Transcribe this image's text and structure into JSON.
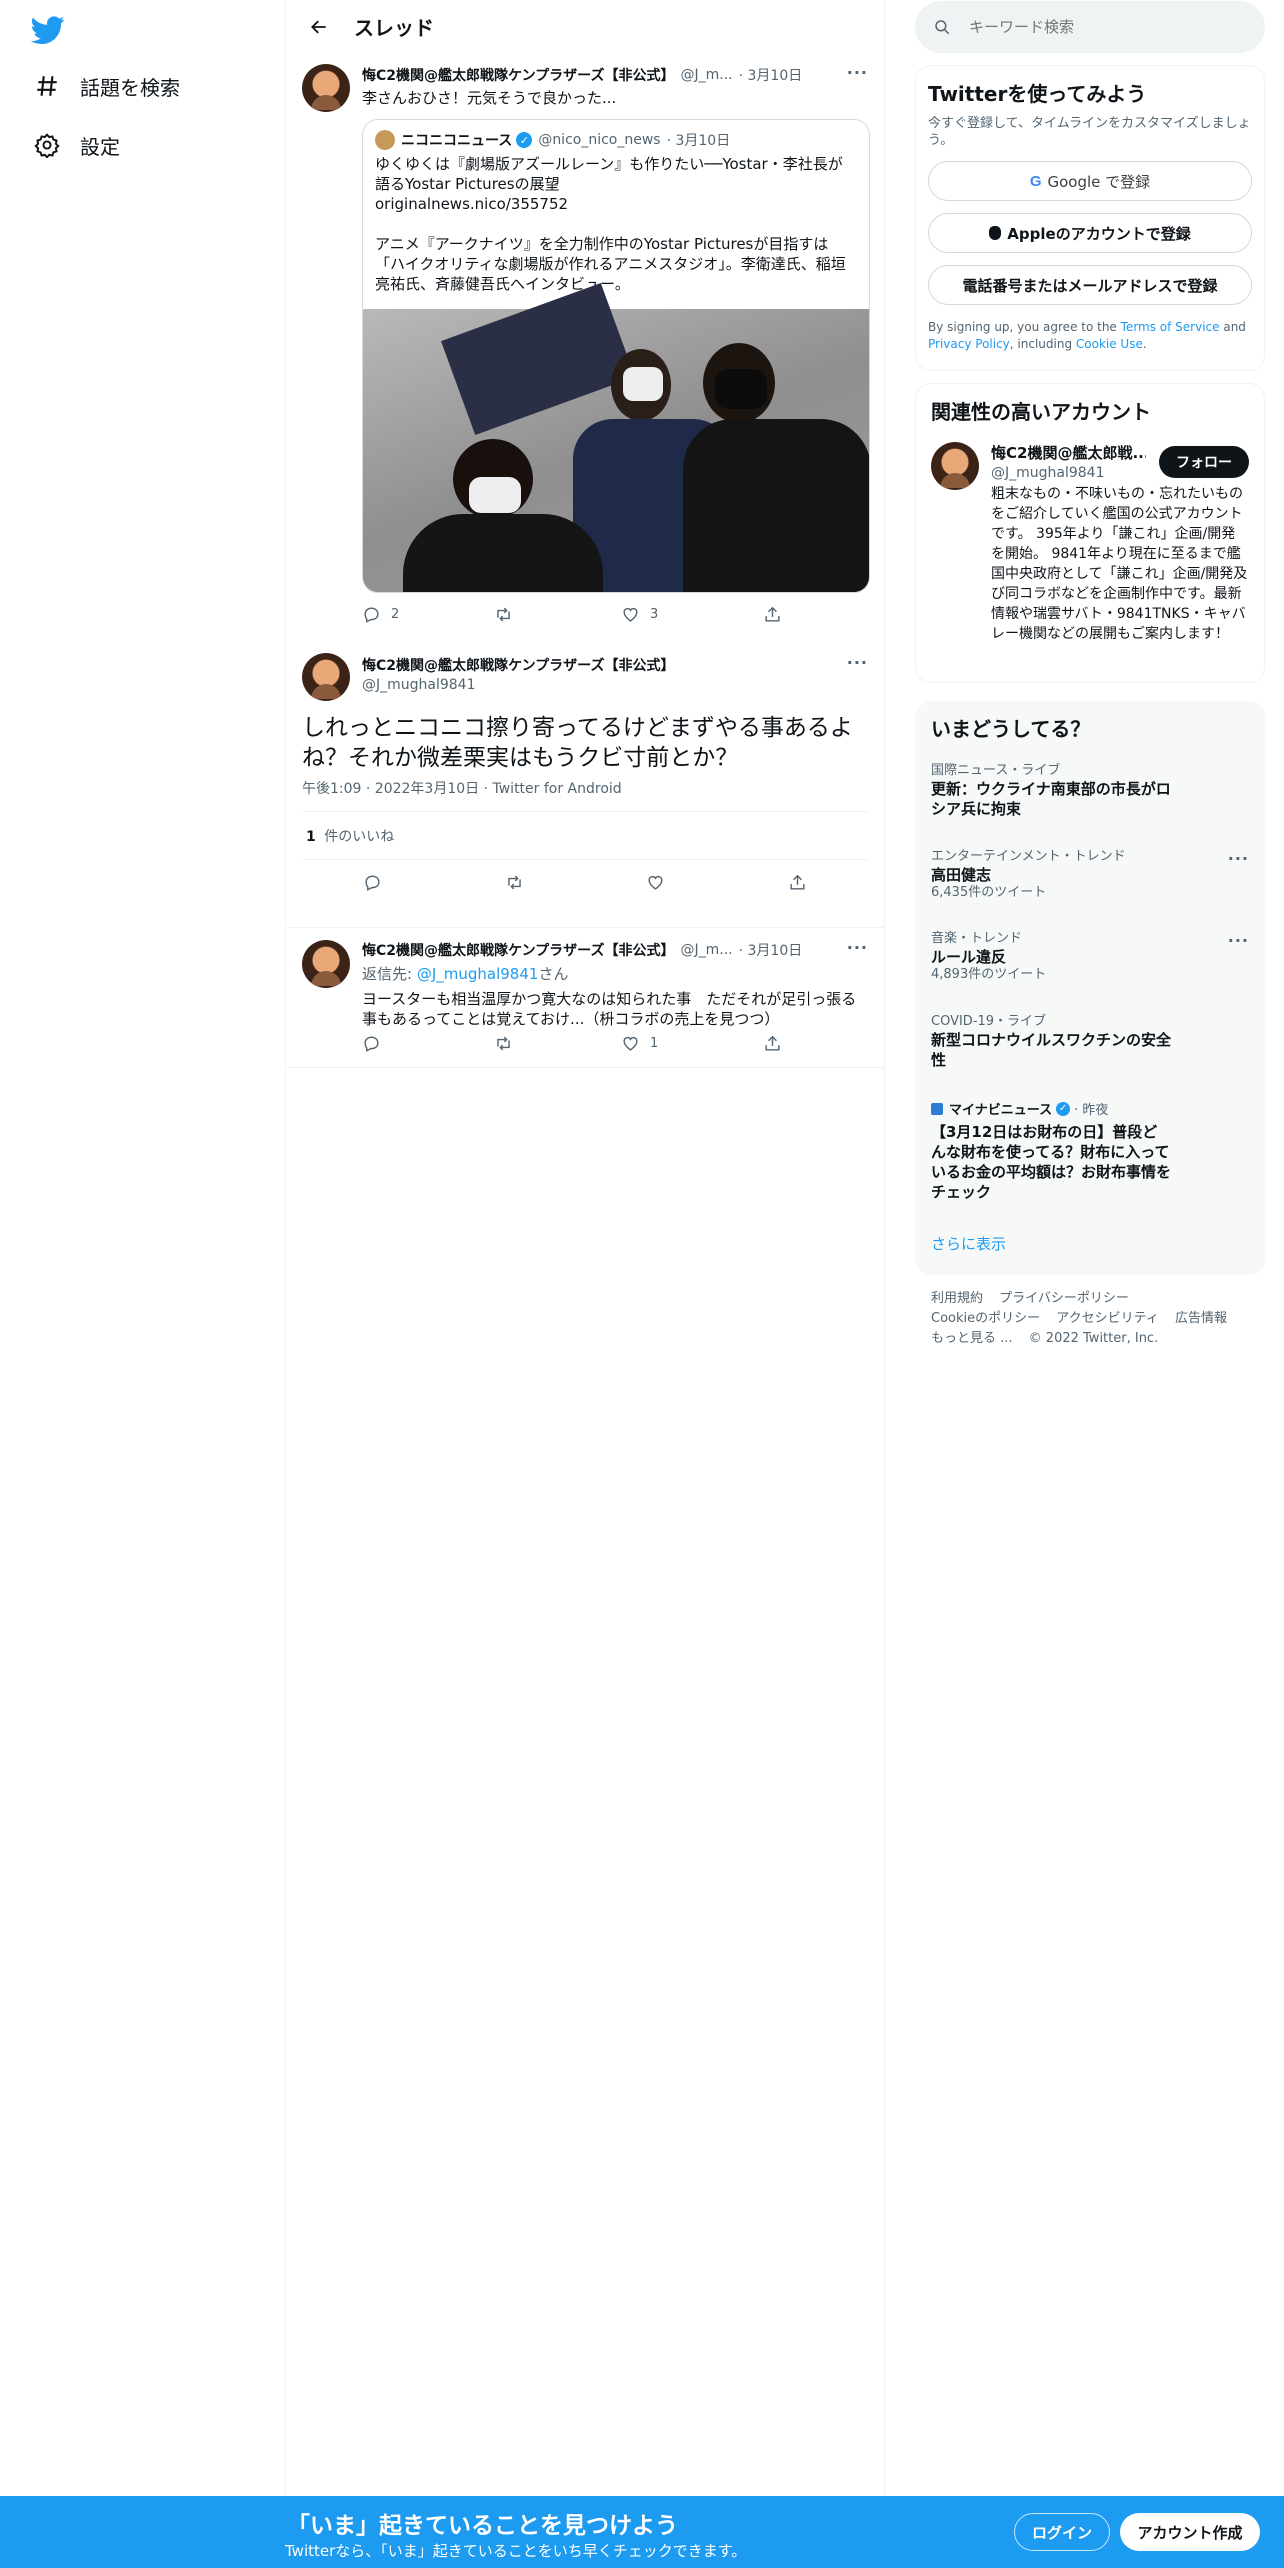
{
  "nav": {
    "explore_label": "話題を検索",
    "settings_label": "設定"
  },
  "header": {
    "title": "スレッド"
  },
  "tweet1": {
    "name": "悔C2機関@艦太郎戦隊ケンプラザーズ【非公式】",
    "handle": "@J_m...",
    "date": "· 3月10日",
    "text": "李さんおひさ！元気そうで良かった...",
    "quote": {
      "name": "ニコニコニュース",
      "handle": "@nico_nico_news",
      "date": "· 3月10日",
      "text1": "ゆくゆくは『劇場版アズールレーン』も作りたい──Yostar・李社長が語るYostar Picturesの展望",
      "text2": "originalnews.nico/355752",
      "text3": "アニメ『アークナイツ』を全力制作中のYostar Picturesが目指すは「ハイクオリティな劇場版が作れるアニメスタジオ」。李衛達氏、稲垣亮祐氏、斉藤健吾氏へインタビュー。"
    },
    "reply_count": "2",
    "like_count": "3"
  },
  "main_tweet": {
    "name": "悔C2機関@艦太郎戦隊ケンプラザーズ【非公式】",
    "handle": "@J_mughal9841",
    "text": "しれっとニコニコ擦り寄ってるけどまずやる事あるよね？それか微差栗実はもうクビ寸前とか？",
    "meta": "午後1:09 · 2022年3月10日 · Twitter for Android",
    "likes_count": "1",
    "likes_label": "件のいいね"
  },
  "reply": {
    "name": "悔C2機関@艦太郎戦隊ケンプラザーズ【非公式】",
    "handle": "@J_m...",
    "date": "· 3月10日",
    "reply_prefix": "返信先: ",
    "reply_to": "@J_mughal9841",
    "reply_suffix": "さん",
    "text": "ヨースターも相当温厚かつ寛大なのは知られた事　ただそれが足引っ張る事もあるってことは覚えておけ...（枡コラボの売上を見つつ）",
    "like_count": "1"
  },
  "right": {
    "search_placeholder": "キーワード検索",
    "signup": {
      "title": "Twitterを使ってみよう",
      "desc": "今すぐ登録して、タイムラインをカスタマイズしましょう。",
      "google": "Google で登録",
      "apple": "Appleのアカウントで登録",
      "phone": "電話番号またはメールアドレスで登録",
      "legal1": "By signing up, you agree to the ",
      "tos": "Terms of Service",
      "legal2": " and ",
      "privacy": "Privacy Policy",
      "legal3": ", including ",
      "cookie": "Cookie Use",
      "legal4": "."
    },
    "relevant": {
      "title": "関連性の高いアカウント",
      "name": "悔C2機関@艦太郎戦...",
      "handle": "@J_mughal9841",
      "follow": "フォロー",
      "bio": "粗末なもの・不味いもの・忘れたいものをご紹介していく艦国の公式アカウントです。 395年より「謙これ」企画/開発を開始。 9841年より現在に至るまで艦国中央政府として「謙これ」企画/開発及び同コラボなどを企画制作中です。最新情報や瑞雲サバト・9841TNKS・キャバレー機関などの展開もご案内します！"
    },
    "trends": {
      "title": "いまどうしてる？",
      "items": [
        {
          "sub": "国際ニュース・ライブ",
          "main": "更新：ウクライナ南東部の市長がロシア兵に拘束",
          "count": ""
        },
        {
          "sub": "エンターテインメント・トレンド",
          "main": "高田健志",
          "count": "6,435件のツイート"
        },
        {
          "sub": "音楽・トレンド",
          "main": "ルール違反",
          "count": "4,893件のツイート"
        },
        {
          "sub": "COVID-19・ライブ",
          "main": "新型コロナウイルスワクチンの安全性",
          "count": ""
        }
      ],
      "news_source": "マイナビニュース",
      "news_time": "· 昨夜",
      "news_text": "【3月12日はお財布の日】普段どんな財布を使ってる？財布に入っているお金の平均額は？お財布事情をチェック",
      "show_more": "さらに表示"
    },
    "footer": {
      "tos": "利用規約",
      "privacy": "プライバシーポリシー",
      "cookie": "Cookieのポリシー",
      "accessibility": "アクセシビリティ",
      "ads": "広告情報",
      "more": "もっと見る ...",
      "copyright": "© 2022 Twitter, Inc."
    }
  },
  "bottom_bar": {
    "title": "「いま」起きていることを見つけよう",
    "subtitle": "Twitterなら、「いま」起きていることをいち早くチェックできます。",
    "login": "ログイン",
    "signup": "アカウント作成"
  },
  "colors": {
    "accent": "#1d9bf0",
    "text": "#0f1419",
    "muted": "#536471"
  }
}
